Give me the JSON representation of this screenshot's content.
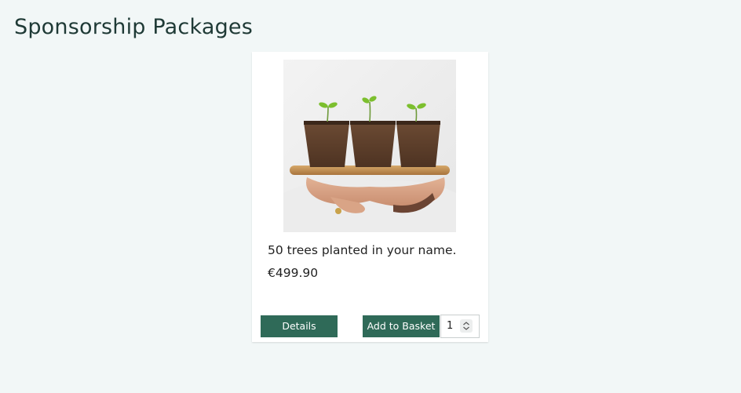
{
  "page": {
    "title": "Sponsorship Packages"
  },
  "product": {
    "image_alt": "Three seedlings in peat pots on a wooden tray",
    "name": "50 trees planted in your name.",
    "price": "€499.90",
    "quantity": "1",
    "details_label": "Details",
    "add_to_basket_label": "Add to Basket"
  },
  "colors": {
    "background": "#f2f7f7",
    "primary_button": "#2f6a58",
    "title_text": "#1f3a36"
  }
}
